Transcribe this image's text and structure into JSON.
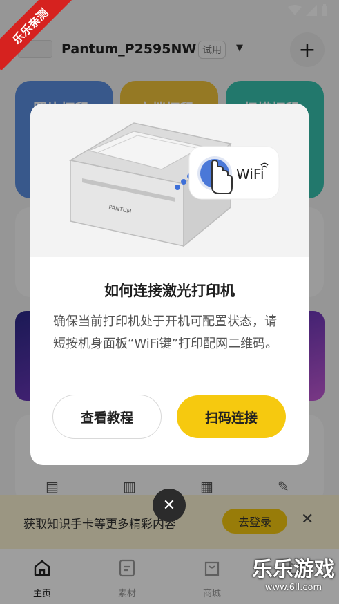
{
  "header": {
    "printer_name": "Pantum_P2595NW",
    "trial_badge": "试用",
    "add_icon": "plus-icon",
    "caret_icon": "caret-down-icon"
  },
  "function_cards": [
    {
      "label": "照片打印",
      "color": "#5b8fe0"
    },
    {
      "label": "文档打印",
      "color": "#f1c33b"
    },
    {
      "label": "扫描打印",
      "color": "#37c2ae"
    }
  ],
  "dialog": {
    "illustration": {
      "printer_brand": "PANTUM",
      "wifi_label": "WiFi"
    },
    "title": "如何连接激光打印机",
    "description": "确保当前打印机处于开机可配置状态，请短按机身面板“WiFi键”打印配网二维码。",
    "secondary_button": "查看教程",
    "primary_button": "扫码连接",
    "close_icon": "close-icon",
    "accent_color": "#f6c90f"
  },
  "promo": {
    "text": "获取知识手卡等更多精彩内容",
    "login_button": "去登录"
  },
  "tabbar": {
    "tabs": [
      {
        "label": "主页",
        "icon": "home-icon",
        "active": true
      },
      {
        "label": "素材",
        "icon": "material-icon",
        "active": false
      },
      {
        "label": "商城",
        "icon": "shop-bag-icon",
        "active": false
      },
      {
        "label": "",
        "icon": "cat-profile-icon",
        "active": false
      }
    ]
  },
  "watermark": {
    "ribbon_text": "乐乐亲测",
    "brand_title": "乐乐游戏",
    "brand_url": "www.6ll.com"
  }
}
